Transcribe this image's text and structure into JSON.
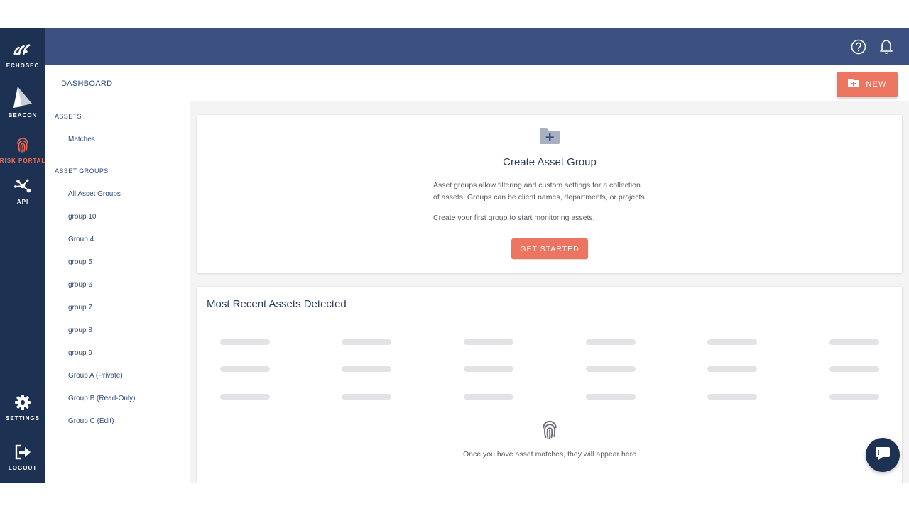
{
  "rail": {
    "brand_label": "ECHOSEC",
    "beacon_label": "BEACON",
    "risk_label": "RISK PORTAL",
    "api_label": "API",
    "settings_label": "SETTINGS",
    "logout_label": "LOGOUT",
    "active_color": "#ec6d5a"
  },
  "topbar": {
    "icons": [
      "help-icon",
      "bell-icon"
    ]
  },
  "header": {
    "breadcrumb": "DASHBOARD",
    "new_label": "NEW"
  },
  "sidebar": {
    "assets_title": "ASSETS",
    "matches": "Matches",
    "groups_title": "ASSET GROUPS",
    "groups": [
      "All Asset Groups",
      "group 10",
      "Group 4",
      "group 5",
      "group 6",
      "group 7",
      "group 8",
      "group 9",
      "Group A (Private)",
      "Group B (Read-Only)",
      "Group C (Edit)"
    ]
  },
  "create_card": {
    "title": "Create Asset Group",
    "desc_line1": "Asset groups allow filtering and custom settings for a collection",
    "desc_line2": "of assets. Groups can be client names, departments, or projects.",
    "desc_line3": "Create your first group to start monitoring assets.",
    "button": "GET STARTED"
  },
  "recent_card": {
    "title": "Most Recent Assets Detected",
    "empty_text": "Once you have asset matches, they will appear here"
  },
  "colors": {
    "accent": "#ec7562",
    "rail": "#1d3152",
    "topbar": "#3c5180",
    "text": "#2e4a7a"
  }
}
